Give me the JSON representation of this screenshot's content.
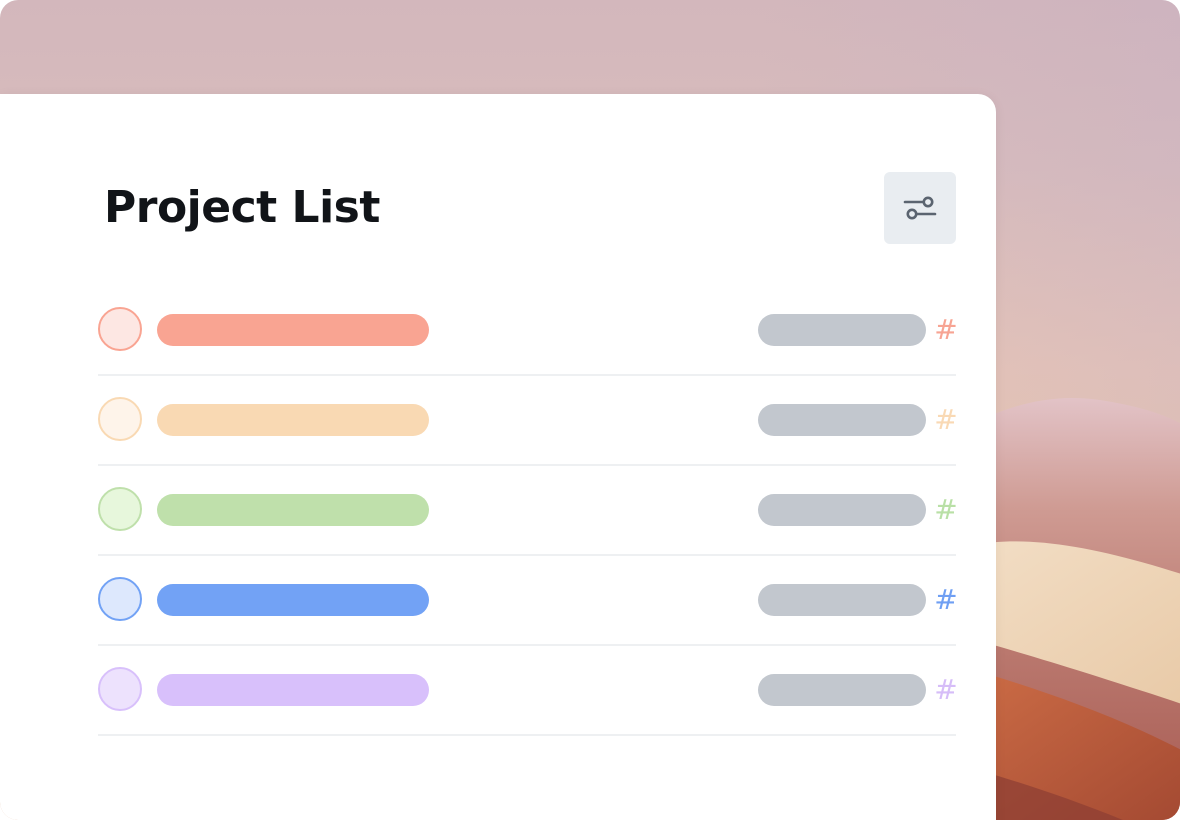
{
  "header": {
    "title": "Project List",
    "filter_icon": "sliders-icon"
  },
  "projects": [
    {
      "hash": "#",
      "color": "#f9a492",
      "fill": "#fde7e3",
      "hash_color": "#f7a493"
    },
    {
      "hash": "#",
      "color": "#f9d9b3",
      "fill": "#fef4ea",
      "hash_color": "#f9d9b4"
    },
    {
      "hash": "#",
      "color": "#bfe0ab",
      "fill": "#e7f7dc",
      "hash_color": "#b9e0a6"
    },
    {
      "hash": "#",
      "color": "#72a2f5",
      "fill": "#dde8fd",
      "hash_color": "#6f9ff3"
    },
    {
      "hash": "#",
      "color": "#d8c0fb",
      "fill": "#ede2fd",
      "hash_color": "#d6bdf8"
    }
  ],
  "colors": {
    "placeholder_bar": "#c2c7ce",
    "divider": "#eef0f2",
    "button_bg": "#e9edf1",
    "icon": "#5b6470"
  }
}
